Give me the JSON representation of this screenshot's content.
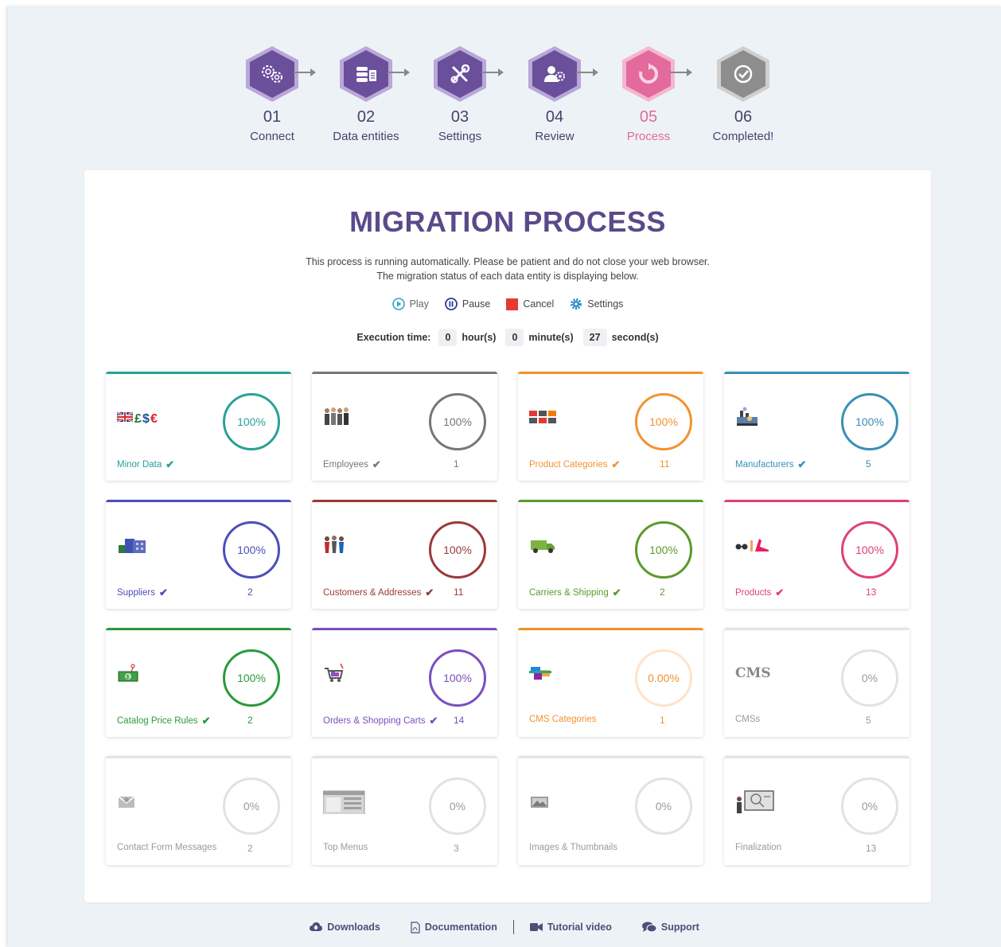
{
  "steps": [
    {
      "num": "01",
      "label": "Connect",
      "icon": "gears-icon",
      "color": "#6a4f9b"
    },
    {
      "num": "02",
      "label": "Data entities",
      "icon": "database-icon",
      "color": "#6a4f9b"
    },
    {
      "num": "03",
      "label": "Settings",
      "icon": "wrench-screwdriver-icon",
      "color": "#6a4f9b"
    },
    {
      "num": "04",
      "label": "Review",
      "icon": "user-gear-icon",
      "color": "#6a4f9b"
    },
    {
      "num": "05",
      "label": "Process",
      "icon": "refresh-icon",
      "color": "#e36a9c"
    },
    {
      "num": "06",
      "label": "Completed!",
      "icon": "check-circle-icon",
      "color": "#8d8d8d"
    }
  ],
  "main": {
    "title": "MIGRATION PROCESS",
    "desc_line1": "This process is running automatically. Please be patient and do not close your web browser.",
    "desc_line2": "The migration status of each data entity is displaying below."
  },
  "controls": {
    "play": "Play",
    "pause": "Pause",
    "cancel": "Cancel",
    "settings": "Settings"
  },
  "exec": {
    "label": "Execution time:",
    "hours": "0",
    "hours_unit": "hour(s)",
    "minutes": "0",
    "minutes_unit": "minute(s)",
    "seconds": "27",
    "seconds_unit": "second(s)"
  },
  "entities": [
    {
      "name": "Minor Data",
      "pct": "100%",
      "count": "",
      "color": "#2aa198",
      "done": true,
      "icon": "flag-currency-icon"
    },
    {
      "name": "Employees",
      "pct": "100%",
      "count": "1",
      "color": "#777777",
      "done": true,
      "icon": "employees-icon"
    },
    {
      "name": "Product Categories",
      "pct": "100%",
      "count": "11",
      "color": "#f39230",
      "done": true,
      "icon": "categories-icon"
    },
    {
      "name": "Manufacturers",
      "pct": "100%",
      "count": "5",
      "color": "#3a8fb7",
      "done": true,
      "icon": "factory-icon"
    },
    {
      "name": "Suppliers",
      "pct": "100%",
      "count": "2",
      "color": "#4b4fb8",
      "done": true,
      "icon": "buildings-icon"
    },
    {
      "name": "Customers & Addresses",
      "pct": "100%",
      "count": "11",
      "color": "#9a3a3a",
      "done": true,
      "icon": "people-icon"
    },
    {
      "name": "Carriers & Shipping",
      "pct": "100%",
      "count": "2",
      "color": "#5a9a2a",
      "done": true,
      "icon": "truck-icon"
    },
    {
      "name": "Products",
      "pct": "100%",
      "count": "13",
      "color": "#e0407a",
      "done": true,
      "icon": "products-icon"
    },
    {
      "name": "Catalog Price Rules",
      "pct": "100%",
      "count": "2",
      "color": "#2a9a3a",
      "done": true,
      "icon": "money-icon"
    },
    {
      "name": "Orders & Shopping Carts",
      "pct": "100%",
      "count": "14",
      "color": "#7a4fbf",
      "done": true,
      "icon": "cart-icon"
    },
    {
      "name": "CMS Categories",
      "pct": "0.00%",
      "count": "1",
      "color": "#f39230",
      "done": false,
      "icon": "cms-categories-icon"
    },
    {
      "name": "CMSs",
      "pct": "0%",
      "count": "5",
      "color": "#9a9a9a",
      "done": false,
      "icon": "cms-icon",
      "icon_text": "CMS"
    },
    {
      "name": "Contact Form Messages",
      "pct": "0%",
      "count": "2",
      "color": "#9a9a9a",
      "done": false,
      "icon": "envelope-icon"
    },
    {
      "name": "Top Menus",
      "pct": "0%",
      "count": "3",
      "color": "#9a9a9a",
      "done": false,
      "icon": "menu-icon"
    },
    {
      "name": "Images & Thumbnails",
      "pct": "0%",
      "count": "",
      "color": "#9a9a9a",
      "done": false,
      "icon": "images-icon"
    },
    {
      "name": "Finalization",
      "pct": "0%",
      "count": "13",
      "color": "#9a9a9a",
      "done": false,
      "icon": "presentation-icon"
    }
  ],
  "footer": {
    "downloads": "Downloads",
    "documentation": "Documentation",
    "tutorial": "Tutorial video",
    "support": "Support"
  }
}
